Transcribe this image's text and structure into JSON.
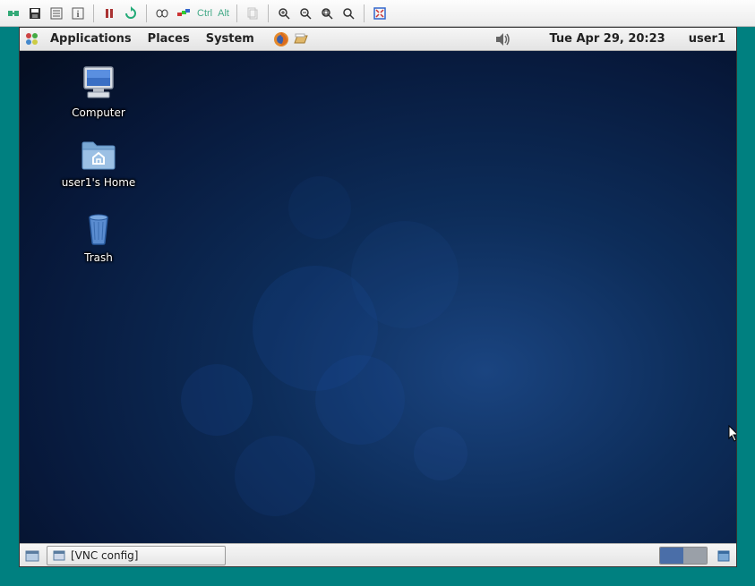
{
  "vnc_toolbar": {
    "ctrl_label": "Ctrl",
    "alt_label": "Alt"
  },
  "panel": {
    "menus": [
      "Applications",
      "Places",
      "System"
    ],
    "clock": "Tue Apr 29, 20:23",
    "user": "user1"
  },
  "desktop_icons": {
    "computer": "Computer",
    "home": "user1's Home",
    "trash": "Trash"
  },
  "taskbar": {
    "window_title": "[VNC config]"
  }
}
